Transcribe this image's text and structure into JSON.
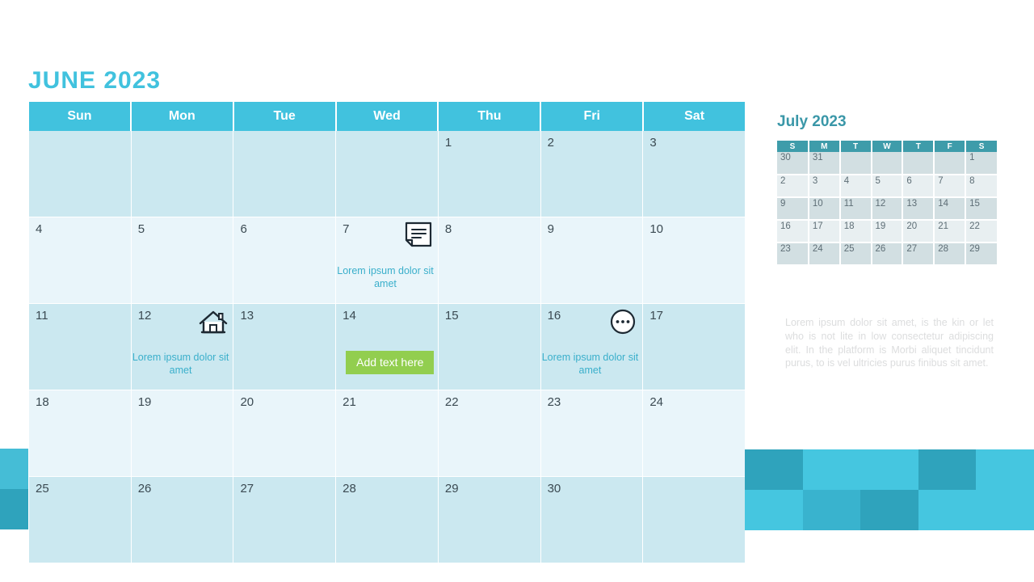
{
  "title": "JUNE 2023",
  "accent_color": "#41C2DE",
  "green_color": "#92CE4F",
  "weekday_headers": [
    "Sun",
    "Mon",
    "Tue",
    "Wed",
    "Thu",
    "Fri",
    "Sat"
  ],
  "weeks": [
    [
      {
        "day": ""
      },
      {
        "day": ""
      },
      {
        "day": ""
      },
      {
        "day": ""
      },
      {
        "day": "1"
      },
      {
        "day": "2"
      },
      {
        "day": "3"
      }
    ],
    [
      {
        "day": "4"
      },
      {
        "day": "5"
      },
      {
        "day": "6"
      },
      {
        "day": "7",
        "icon": "note-icon",
        "note": "Lorem ipsum dolor sit amet"
      },
      {
        "day": "8"
      },
      {
        "day": "9"
      },
      {
        "day": "10"
      }
    ],
    [
      {
        "day": "11"
      },
      {
        "day": "12",
        "icon": "house-icon",
        "note": "Lorem ipsum dolor sit amet"
      },
      {
        "day": "13"
      },
      {
        "day": "14",
        "button": "Add text here"
      },
      {
        "day": "15"
      },
      {
        "day": "16",
        "icon": "more-circle-icon",
        "note": "Lorem ipsum dolor sit amet"
      },
      {
        "day": "17"
      }
    ],
    [
      {
        "day": "18"
      },
      {
        "day": "19"
      },
      {
        "day": "20"
      },
      {
        "day": "21"
      },
      {
        "day": "22"
      },
      {
        "day": "23"
      },
      {
        "day": "24"
      }
    ],
    [
      {
        "day": "25"
      },
      {
        "day": "26"
      },
      {
        "day": "27"
      },
      {
        "day": "28"
      },
      {
        "day": "29"
      },
      {
        "day": "30"
      },
      {
        "day": ""
      }
    ]
  ],
  "mini_calendar": {
    "title": "July 2023",
    "weekday_headers": [
      "S",
      "M",
      "T",
      "W",
      "T",
      "F",
      "S"
    ],
    "weeks": [
      [
        "30",
        "31",
        "",
        "",
        "",
        "",
        "1"
      ],
      [
        "2",
        "3",
        "4",
        "5",
        "6",
        "7",
        "8"
      ],
      [
        "9",
        "10",
        "11",
        "12",
        "13",
        "14",
        "15"
      ],
      [
        "16",
        "17",
        "18",
        "19",
        "20",
        "21",
        "22"
      ],
      [
        "23",
        "24",
        "25",
        "26",
        "27",
        "28",
        "29"
      ]
    ],
    "header_color": "#3E9CAA"
  },
  "paragraph": "Lorem ipsum dolor sit amet, is the kin or let who is not lite   in low consectetur adipiscing elit. In the platform is Morbi aliquet tincidunt purus, to is vel ultricies purus finibus sit amet.",
  "decoration": {
    "left_colors": [
      "#45BDD6",
      "#2FA3BC"
    ],
    "right_colors": [
      [
        "#2FA3BC",
        "#45C6E0",
        "#45C6E0",
        "#2FA3BC",
        "#45C6E0"
      ],
      [
        "#45C6E0",
        "#39B3CE",
        "#2FA3BC",
        "#45C6E0",
        "#45C6E0"
      ]
    ]
  }
}
